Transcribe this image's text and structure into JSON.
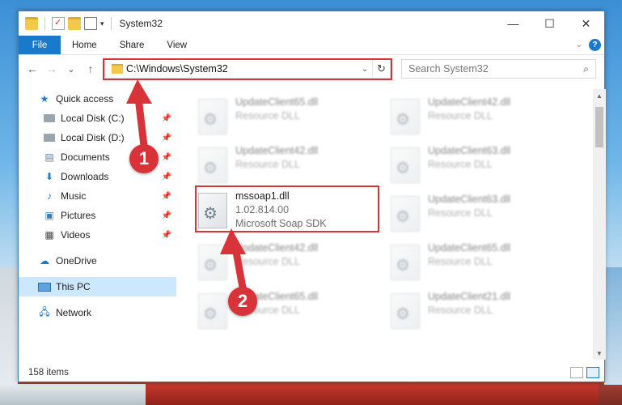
{
  "window": {
    "title": "System32",
    "controls": {
      "minimize": "—",
      "maximize": "☐",
      "close": "✕"
    }
  },
  "ribbon": {
    "tabs": [
      "File",
      "Home",
      "Share",
      "View"
    ],
    "help": "?"
  },
  "nav_buttons": {
    "back": "←",
    "forward": "→",
    "recent": "⌄",
    "up": "↑"
  },
  "address": {
    "path": "C:\\Windows\\System32",
    "refresh": "↻",
    "dropdown": "⌄"
  },
  "search": {
    "placeholder": "Search System32",
    "icon": "⌕"
  },
  "sidebar": {
    "quick_access": "Quick access",
    "items": [
      {
        "label": "Local Disk (C:)",
        "icon": "drive-icon",
        "pinned": true
      },
      {
        "label": "Local Disk (D:)",
        "icon": "drive-icon",
        "pinned": true
      },
      {
        "label": "Documents",
        "icon": "documents-icon",
        "pinned": true
      },
      {
        "label": "Downloads",
        "icon": "downloads-icon",
        "pinned": true
      },
      {
        "label": "Music",
        "icon": "music-icon",
        "pinned": true
      },
      {
        "label": "Pictures",
        "icon": "pictures-icon",
        "pinned": true
      },
      {
        "label": "Videos",
        "icon": "videos-icon",
        "pinned": true
      }
    ],
    "onedrive": "OneDrive",
    "this_pc": "This PC",
    "network": "Network"
  },
  "files": [
    {
      "name": "UpdateClient65.dll",
      "type": "Resource DLL",
      "blurred": true
    },
    {
      "name": "UpdateClient42.dll",
      "type": "Resource DLL",
      "blurred": true
    },
    {
      "name": "UpdateClient42.dll",
      "type": "Resource DLL",
      "blurred": true
    },
    {
      "name": "UpdateClient63.dll",
      "type": "Resource DLL",
      "blurred": true
    },
    {
      "name": "mssoap1.dll",
      "type": "1.02.814.00",
      "desc": "Microsoft Soap SDK",
      "blurred": false
    },
    {
      "name": "UpdateClient63.dll",
      "type": "Resource DLL",
      "blurred": true
    },
    {
      "name": "UpdateClient42.dll",
      "type": "Resource DLL",
      "blurred": true
    },
    {
      "name": "UpdateClient65.dll",
      "type": "Resource DLL",
      "blurred": true
    },
    {
      "name": "UpdateClient65.dll",
      "type": "Resource DLL",
      "blurred": true
    },
    {
      "name": "UpdateClient21.dll",
      "type": "Resource DLL",
      "blurred": true
    }
  ],
  "status": {
    "item_count": "158 items"
  },
  "callouts": {
    "one": "1",
    "two": "2"
  },
  "colors": {
    "accent": "#1979ca",
    "highlight": "#d9333a",
    "selected": "#cce8ff"
  }
}
